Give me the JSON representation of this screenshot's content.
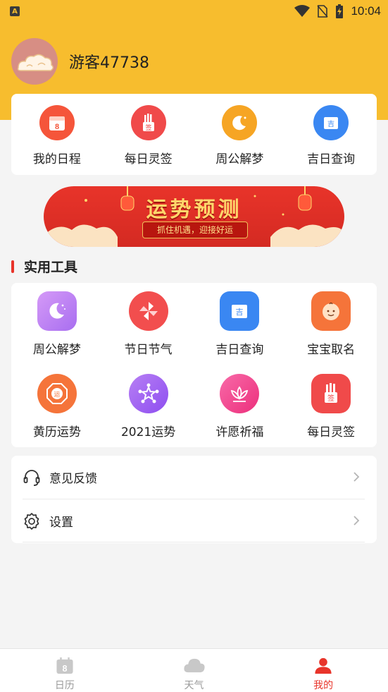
{
  "status_bar": {
    "app_badge": "A",
    "time": "10:04"
  },
  "profile": {
    "username": "游客47738"
  },
  "quick_actions": [
    {
      "label": "我的日程",
      "icon": "calendar-icon",
      "color": "#f5553a",
      "badge": "8"
    },
    {
      "label": "每日灵签",
      "icon": "fortune-stick-icon",
      "color": "#f04a4a",
      "badge": "签"
    },
    {
      "label": "周公解梦",
      "icon": "moon-icon",
      "color": "#f6a524"
    },
    {
      "label": "吉日查询",
      "icon": "auspicious-day-icon",
      "color": "#3a87f2",
      "badge": "吉"
    }
  ],
  "banner": {
    "title": "运势预测",
    "subtitle": "抓住机遇，迎接好运"
  },
  "section": {
    "title": "实用工具"
  },
  "tools": [
    {
      "label": "周公解梦",
      "icon": "moon-icon",
      "color": "#c27ff2"
    },
    {
      "label": "节日节气",
      "icon": "pinwheel-icon",
      "color": "#f24e4e"
    },
    {
      "label": "吉日查询",
      "icon": "auspicious-day-icon",
      "color": "#3a87f2",
      "badge": "吉"
    },
    {
      "label": "宝宝取名",
      "icon": "baby-face-icon",
      "color": "#f5743a"
    },
    {
      "label": "黄历运势",
      "icon": "almanac-icon",
      "color": "#f5743a",
      "badge": "运"
    },
    {
      "label": "2021运势",
      "icon": "star-network-icon",
      "color": "#a05ff0"
    },
    {
      "label": "许愿祈福",
      "icon": "lotus-icon",
      "color": "#f23e8a"
    },
    {
      "label": "每日灵签",
      "icon": "fortune-stick-icon",
      "color": "#f04a4a",
      "badge": "签"
    }
  ],
  "settings": [
    {
      "label": "意见反馈",
      "icon": "headset-icon"
    },
    {
      "label": "设置",
      "icon": "gear-icon"
    }
  ],
  "tabbar": [
    {
      "label": "日历",
      "icon": "calendar-tab-icon",
      "badge": "8",
      "active": false
    },
    {
      "label": "天气",
      "icon": "cloud-icon",
      "active": false
    },
    {
      "label": "我的",
      "icon": "person-icon",
      "active": true
    }
  ],
  "colors": {
    "header": "#f7bd2e",
    "accent": "#e8342a"
  }
}
